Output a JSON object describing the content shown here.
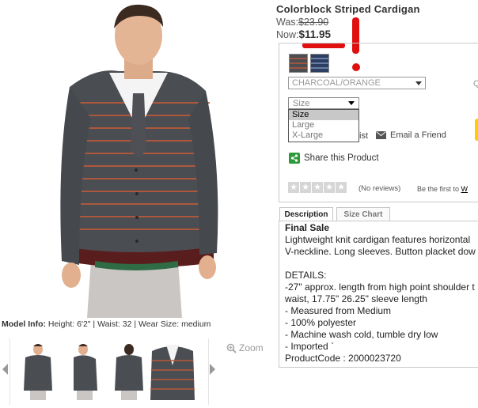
{
  "product": {
    "title": "Colorblock Striped Cardigan",
    "was_label": "Was:",
    "was_price": "$23.90",
    "now_label": "Now:",
    "now_price": "$11.95"
  },
  "model_info": {
    "label": "Model Info:",
    "text": " Height: 6'2\" | Waist: 32 | Wear Size: medium"
  },
  "gallery": {
    "zoom_label": "Zoom",
    "thumbnails": [
      "front",
      "side",
      "back",
      "closeup"
    ]
  },
  "options": {
    "color": {
      "selected": "CHARCOAL/ORANGE"
    },
    "qty_label": "Q",
    "size": {
      "selected": "Size",
      "options": [
        "Size",
        "Large",
        "X-Large"
      ]
    },
    "wishlist_fragment": "ist",
    "email_friend": "Email a Friend",
    "share": "Share this Product",
    "reviews": "(No reviews)",
    "first_to_prefix": "Be the first to ",
    "first_to_link": "W"
  },
  "tabs": {
    "description": "Description",
    "size_chart": "Size Chart"
  },
  "description": {
    "lines": [
      "Final Sale",
      "Lightweight knit cardigan features horizontal",
      "V-neckline. Long sleeves. Button placket dow",
      "",
      "DETAILS:",
      "-27\" approx. length from high point shoulder t",
      "waist, 17.75\" 26.25\" sleeve length",
      "- Measured from Medium",
      "- 100% polyester",
      "- Machine wash cold, tumble dry low",
      "- Imported `",
      "ProductCode : 2000023720"
    ]
  },
  "colors": {
    "annotation_red": "#e01010",
    "share_green": "#2e9a3a",
    "cart_yellow": "#ffcc00",
    "cardigan": "#4a4d52",
    "stripe": "#b85a3a"
  }
}
